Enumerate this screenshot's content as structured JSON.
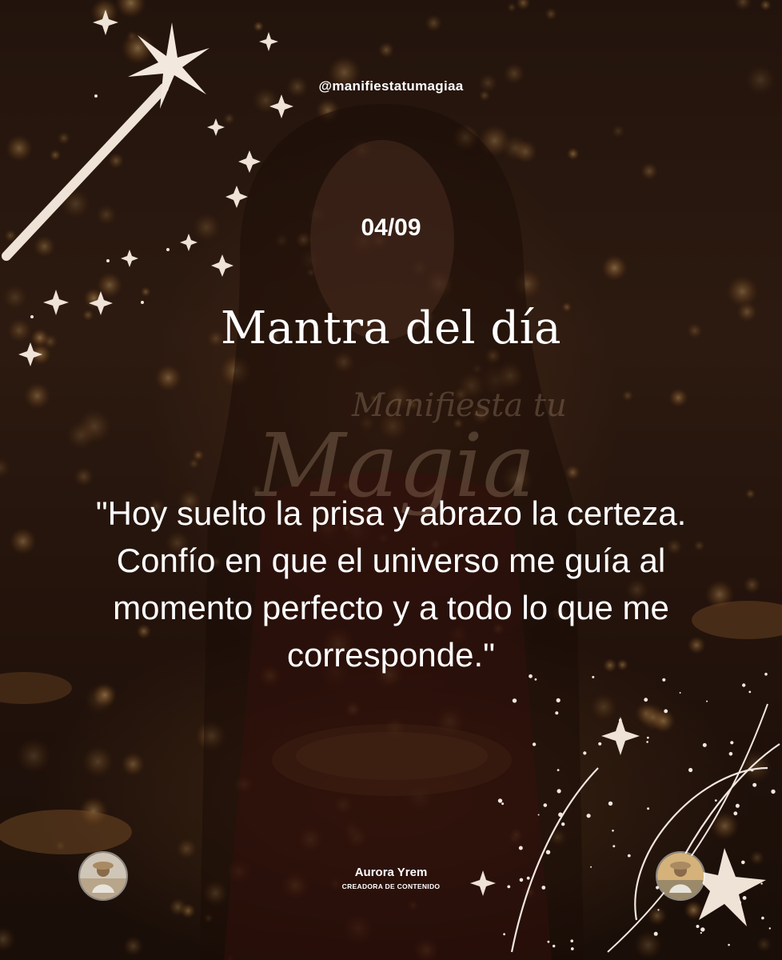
{
  "post": {
    "handle": "@manifiestatumagiaa",
    "date": "04/09",
    "title": "Mantra del día",
    "quote": "\"Hoy suelto la prisa y abrazo la certeza. Confío en que el universo me guía al momento perfecto y a todo lo que me corresponde.\"",
    "watermark": "Manifiesta tu Magia"
  },
  "author": {
    "name": "Aurora Yrem",
    "role": "CREADORA DE CONTENIDO"
  },
  "icons": {
    "wand": "magic-wand-icon",
    "star": "sparkle-icon",
    "avatar": "person-avatar"
  },
  "colors": {
    "text": "#ffffff",
    "warm_glow": "#e0a050",
    "decor": "#f2e6e0"
  }
}
